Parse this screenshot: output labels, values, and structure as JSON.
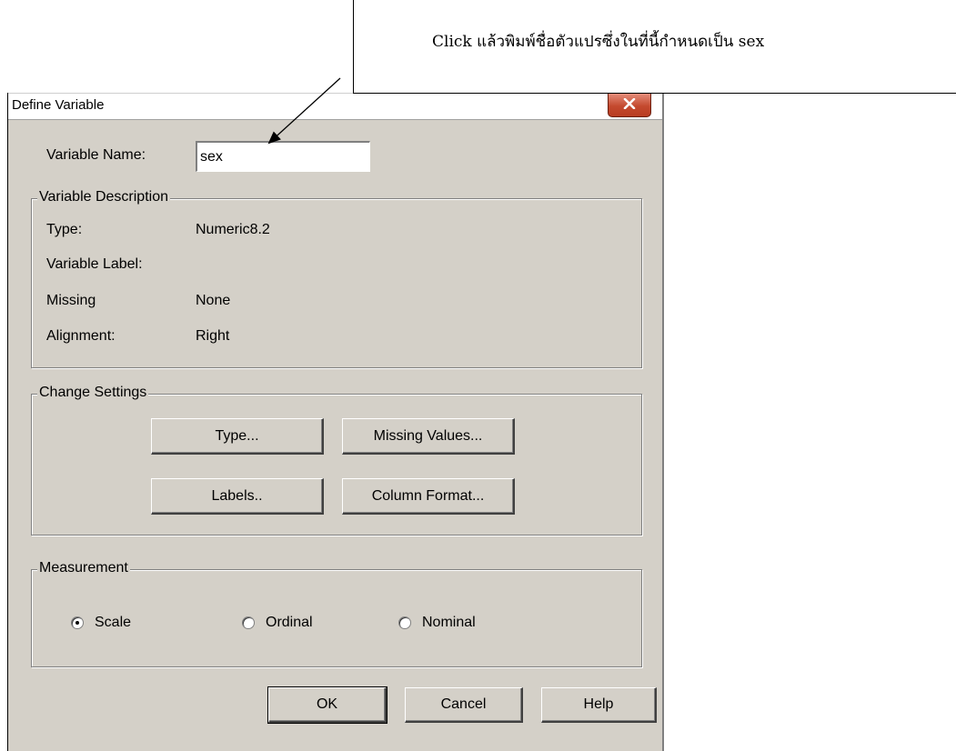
{
  "callout": {
    "text": "Click แล้วพิมพ์ชื่อตัวแปรซึ่งในที่นี้กำหนดเป็น sex"
  },
  "dialog": {
    "title": "Define Variable",
    "close_icon": "close-icon",
    "variable_name_label": "Variable Name:",
    "variable_name_value": "sex",
    "description": {
      "legend": "Variable Description",
      "rows": [
        {
          "label": "Type:",
          "value": "Numeric8.2"
        },
        {
          "label": "Variable Label:",
          "value": ""
        },
        {
          "label": "Missing",
          "value": "None"
        },
        {
          "label": "Alignment:",
          "value": "Right"
        }
      ]
    },
    "settings": {
      "legend": "Change Settings",
      "type_button": "Type...",
      "missing_values_button": "Missing Values...",
      "labels_button": "Labels..",
      "column_format_button": "Column Format..."
    },
    "measurement": {
      "legend": "Measurement",
      "options": [
        "Scale",
        "Ordinal",
        "Nominal"
      ],
      "selected": "Scale"
    },
    "buttons": {
      "ok": "OK",
      "cancel": "Cancel",
      "help": "Help"
    }
  }
}
